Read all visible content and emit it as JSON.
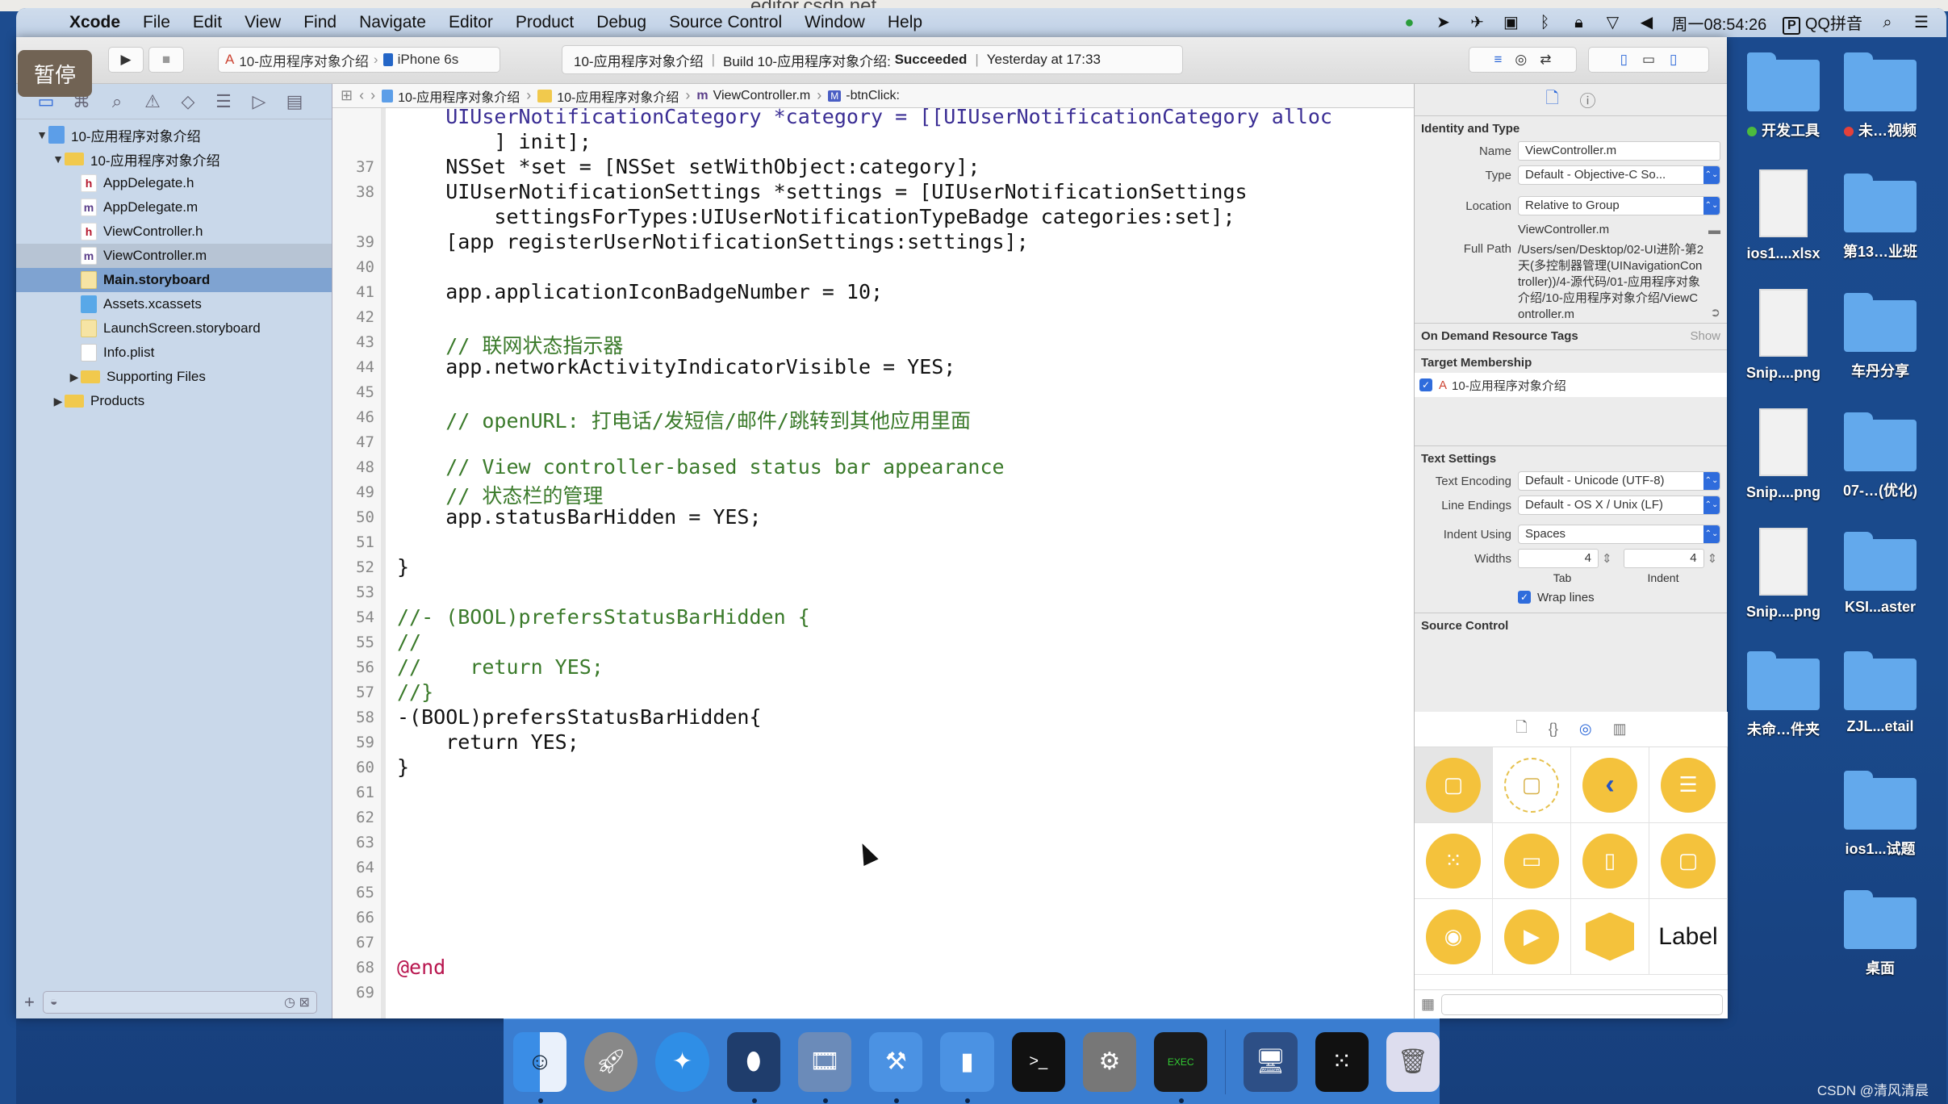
{
  "browser": {
    "url": "editor.csdn.net"
  },
  "menubar": {
    "app": "Xcode",
    "items": [
      "File",
      "Edit",
      "View",
      "Find",
      "Navigate",
      "Editor",
      "Product",
      "Debug",
      "Source Control",
      "Window",
      "Help"
    ],
    "clock": "周一08:54:26",
    "input_method": "QQ拼音"
  },
  "toolbar": {
    "pause_overlay": "暂停",
    "scheme": "10-应用程序对象介绍",
    "device": "iPhone 6s",
    "activity": {
      "project": "10-应用程序对象介绍",
      "build_prefix": "Build 10-应用程序对象介绍:",
      "build_status": "Succeeded",
      "time": "Yesterday at 17:33"
    }
  },
  "navigator": {
    "tree": [
      {
        "label": "10-应用程序对象介绍",
        "icon": "project-icon",
        "level": 0,
        "expanded": true
      },
      {
        "label": "10-应用程序对象介绍",
        "icon": "folder-icon",
        "level": 1,
        "expanded": true
      },
      {
        "label": "AppDelegate.h",
        "icon": "header-file-icon",
        "level": 2
      },
      {
        "label": "AppDelegate.m",
        "icon": "objc-file-icon",
        "level": 2
      },
      {
        "label": "ViewController.h",
        "icon": "header-file-icon",
        "level": 2
      },
      {
        "label": "ViewController.m",
        "icon": "objc-file-icon",
        "level": 2,
        "highlighted": true
      },
      {
        "label": "Main.storyboard",
        "icon": "storyboard-icon",
        "level": 2,
        "selected": true
      },
      {
        "label": "Assets.xcassets",
        "icon": "assets-icon",
        "level": 2
      },
      {
        "label": "LaunchScreen.storyboard",
        "icon": "storyboard-icon",
        "level": 2
      },
      {
        "label": "Info.plist",
        "icon": "plist-icon",
        "level": 2
      },
      {
        "label": "Supporting Files",
        "icon": "folder-icon",
        "level": 2,
        "expanded": false
      },
      {
        "label": "Products",
        "icon": "folder-icon",
        "level": 1,
        "expanded": false
      }
    ]
  },
  "jumpbar": {
    "crumbs": [
      "10-应用程序对象介绍",
      "10-应用程序对象介绍",
      "ViewController.m",
      "-btnClick:"
    ]
  },
  "editor": {
    "lines": [
      {
        "n": "",
        "text": "    UIUserNotificationCategory *category = [[UIUserNotificationCategory alloc",
        "cls": "k-meth"
      },
      {
        "n": "",
        "text": "        ] init];",
        "cls": ""
      },
      {
        "n": "37",
        "text": "    NSSet *set = [NSSet setWithObject:category];",
        "cls": ""
      },
      {
        "n": "38",
        "text": "    UIUserNotificationSettings *settings = [UIUserNotificationSettings",
        "cls": ""
      },
      {
        "n": "",
        "text": "        settingsForTypes:UIUserNotificationTypeBadge categories:set];",
        "cls": ""
      },
      {
        "n": "39",
        "text": "    [app registerUserNotificationSettings:settings];",
        "cls": ""
      },
      {
        "n": "40",
        "text": "",
        "cls": ""
      },
      {
        "n": "41",
        "text": "    app.applicationIconBadgeNumber = 10;",
        "cls": ""
      },
      {
        "n": "42",
        "text": "",
        "cls": ""
      },
      {
        "n": "43",
        "text": "    // 联网状态指示器",
        "cls": "k-cm"
      },
      {
        "n": "44",
        "text": "    app.networkActivityIndicatorVisible = YES;",
        "cls": ""
      },
      {
        "n": "45",
        "text": "",
        "cls": ""
      },
      {
        "n": "46",
        "text": "    // openURL: 打电话/发短信/邮件/跳转到其他应用里面",
        "cls": "k-cm"
      },
      {
        "n": "47",
        "text": "",
        "cls": ""
      },
      {
        "n": "48",
        "text": "    // View controller-based status bar appearance",
        "cls": "k-cm"
      },
      {
        "n": "49",
        "text": "    // 状态栏的管理",
        "cls": "k-cm"
      },
      {
        "n": "50",
        "text": "    app.statusBarHidden = YES;",
        "cls": ""
      },
      {
        "n": "51",
        "text": "",
        "cls": ""
      },
      {
        "n": "52",
        "text": "}",
        "cls": ""
      },
      {
        "n": "53",
        "text": "",
        "cls": ""
      },
      {
        "n": "54",
        "text": "//- (BOOL)prefersStatusBarHidden {",
        "cls": "k-cm"
      },
      {
        "n": "55",
        "text": "//",
        "cls": "k-cm"
      },
      {
        "n": "56",
        "text": "//    return YES;",
        "cls": "k-cm"
      },
      {
        "n": "57",
        "text": "//}",
        "cls": "k-cm"
      },
      {
        "n": "58",
        "text": "-(BOOL)prefersStatusBarHidden{",
        "cls": ""
      },
      {
        "n": "59",
        "text": "    return YES;",
        "cls": ""
      },
      {
        "n": "60",
        "text": "}",
        "cls": ""
      },
      {
        "n": "61",
        "text": "",
        "cls": ""
      },
      {
        "n": "62",
        "text": "",
        "cls": ""
      },
      {
        "n": "63",
        "text": "",
        "cls": ""
      },
      {
        "n": "64",
        "text": "",
        "cls": ""
      },
      {
        "n": "65",
        "text": "",
        "cls": ""
      },
      {
        "n": "66",
        "text": "",
        "cls": ""
      },
      {
        "n": "67",
        "text": "",
        "cls": ""
      },
      {
        "n": "68",
        "text": "@end",
        "cls": "k-kw"
      },
      {
        "n": "69",
        "text": "",
        "cls": ""
      }
    ]
  },
  "inspector": {
    "identity": {
      "title": "Identity and Type",
      "name_label": "Name",
      "name": "ViewController.m",
      "type_label": "Type",
      "type": "Default - Objective-C So...",
      "location_label": "Location",
      "location": "Relative to Group",
      "location_file": "ViewController.m",
      "fullpath_label": "Full Path",
      "fullpath": "/Users/sen/Desktop/02-UI进阶-第2天(多控制器管理(UINavigationController))/4-源代码/01-应用程序对象介绍/10-应用程序对象介绍/ViewController.m"
    },
    "odr": {
      "title": "On Demand Resource Tags",
      "show": "Show"
    },
    "target": {
      "title": "Target Membership",
      "item": "10-应用程序对象介绍",
      "checked": true
    },
    "text_settings": {
      "title": "Text Settings",
      "encoding_label": "Text Encoding",
      "encoding": "Default - Unicode (UTF-8)",
      "endings_label": "Line Endings",
      "endings": "Default - OS X / Unix (LF)",
      "indent_label": "Indent Using",
      "indent": "Spaces",
      "widths_label": "Widths",
      "tab_width": "4",
      "indent_width": "4",
      "tab_label": "Tab",
      "indent_sub_label": "Indent",
      "wrap_label": "Wrap lines",
      "wrap": true
    },
    "source_control": {
      "title": "Source Control"
    },
    "library": {
      "items": [
        "View Controller",
        "Storyboard Reference",
        "Navigation Controller",
        "Table View Controller",
        "Collection View Controller",
        "Tab Bar Controller",
        "Split View Controller",
        "Page View Controller",
        "GLKit View Controller",
        "AVKit Player View Controller",
        "Object",
        "Label"
      ],
      "label_text": "Label"
    }
  },
  "desktop": {
    "icons": [
      {
        "label": "开发工具",
        "kind": "folder",
        "tag": "#4cbb3e"
      },
      {
        "label": "未…视频",
        "kind": "folder",
        "tag": "#e4413a"
      },
      {
        "label": "ios1....xlsx",
        "kind": "file"
      },
      {
        "label": "第13…业班",
        "kind": "folder"
      },
      {
        "label": "Snip....png",
        "kind": "file"
      },
      {
        "label": "车丹分享",
        "kind": "folder"
      },
      {
        "label": "Snip....png",
        "kind": "file"
      },
      {
        "label": "07-…(优化)",
        "kind": "folder"
      },
      {
        "label": "Snip....png",
        "kind": "file"
      },
      {
        "label": "KSI...aster",
        "kind": "folder"
      },
      {
        "label": "未命…件夹",
        "kind": "folder"
      },
      {
        "label": "ZJL...etail",
        "kind": "folder"
      },
      {
        "label": "ios1...试题",
        "kind": "folder"
      },
      {
        "label": "桌面",
        "kind": "folder"
      }
    ],
    "watermark": "CSDN @清风清晨"
  },
  "dock": {
    "apps": [
      "Finder",
      "Launchpad",
      "Safari",
      "Mouse",
      "Photo Booth",
      "Xcode",
      "Simulator",
      "Terminal",
      "System Preferences",
      "Console",
      "Screen",
      "Grid",
      "Trash"
    ]
  }
}
